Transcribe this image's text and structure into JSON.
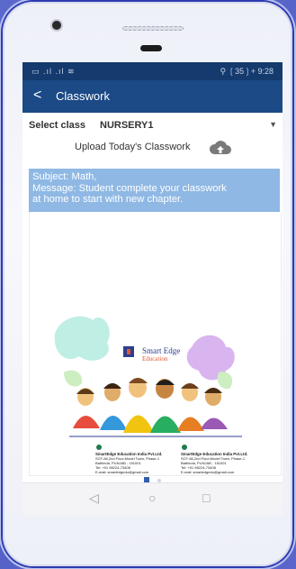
{
  "status_bar": {
    "left_text": "▭ .ıl .ıl ≋",
    "right_text": "⚲ ❲35❳+ 9:28"
  },
  "app_bar": {
    "back_glyph": "<",
    "title": "Classwork"
  },
  "select_class": {
    "label": "Select class",
    "value": "NURSERY1",
    "caret": "▼"
  },
  "upload": {
    "label": "Upload Today's Classwork",
    "icon": "cloud-upload-icon"
  },
  "message": {
    "line1": "Subject: Math,",
    "line2": "Message: Student complete your classwork",
    "line3": "at home to start with new chapter."
  },
  "classwork_image": {
    "brand_top": "Smart Edge",
    "brand_bottom": "Education",
    "contacts": [
      {
        "company": "SmartEdge Education India Pvt.Ltd.",
        "address": "SCF-66,2nd Floor,Model Town, Phase-1",
        "city": "Bathinda, PUNJAB - 151001",
        "tel": "Tel: +91 98224-73408",
        "email": "E-mail: smartedgedu@gmail.com"
      },
      {
        "company": "SmartEdge Education India Pvt.Ltd.",
        "address": "SCF-66,2nd Floor,Model Town, Phase-1",
        "city": "Bathinda, PUNJAB - 151001",
        "tel": "Tel: +91 98224-73408",
        "email": "E-mail: smartedgedu@gmail.com"
      }
    ]
  },
  "pager": {
    "active_index": 0,
    "count": 2
  },
  "nav_bar": {
    "back": "◁",
    "home": "○",
    "recents": "□"
  },
  "colors": {
    "status_bar": "#143a6e",
    "app_bar": "#1b4a86",
    "message_box": "#8fb8e4",
    "background": "#5865c9"
  }
}
